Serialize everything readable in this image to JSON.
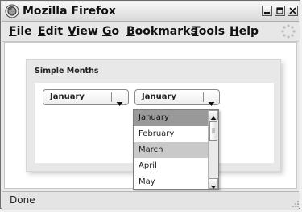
{
  "window": {
    "title": "Mozilla Firefox",
    "icon": "firefox-logo-icon",
    "controls": [
      "minimize-icon",
      "maximize-icon",
      "close-icon"
    ]
  },
  "menubar": {
    "items": [
      "File",
      "Edit",
      "View",
      "Go",
      "Bookmarks",
      "Tools",
      "Help"
    ],
    "throbber_icon": "throbber-icon"
  },
  "panel": {
    "title": "Simple Months",
    "combo_1": {
      "value": "January",
      "arrow_icon": "chevron-down-icon"
    },
    "combo_2": {
      "value": "January",
      "arrow_icon": "chevron-down-icon"
    }
  },
  "dropdown": {
    "options": [
      "January",
      "February",
      "March",
      "April",
      "May"
    ],
    "selected": "January",
    "hovered": "March",
    "scroll_up_icon": "scroll-up-icon",
    "scroll_down_icon": "scroll-down-icon"
  },
  "statusbar": {
    "text": "Done",
    "grip_icon": "resize-grip-icon"
  },
  "colors": {
    "selected_bg": "#999999",
    "hover_bg": "#c9c9c9",
    "panel_bg": "#e8e8e8"
  }
}
